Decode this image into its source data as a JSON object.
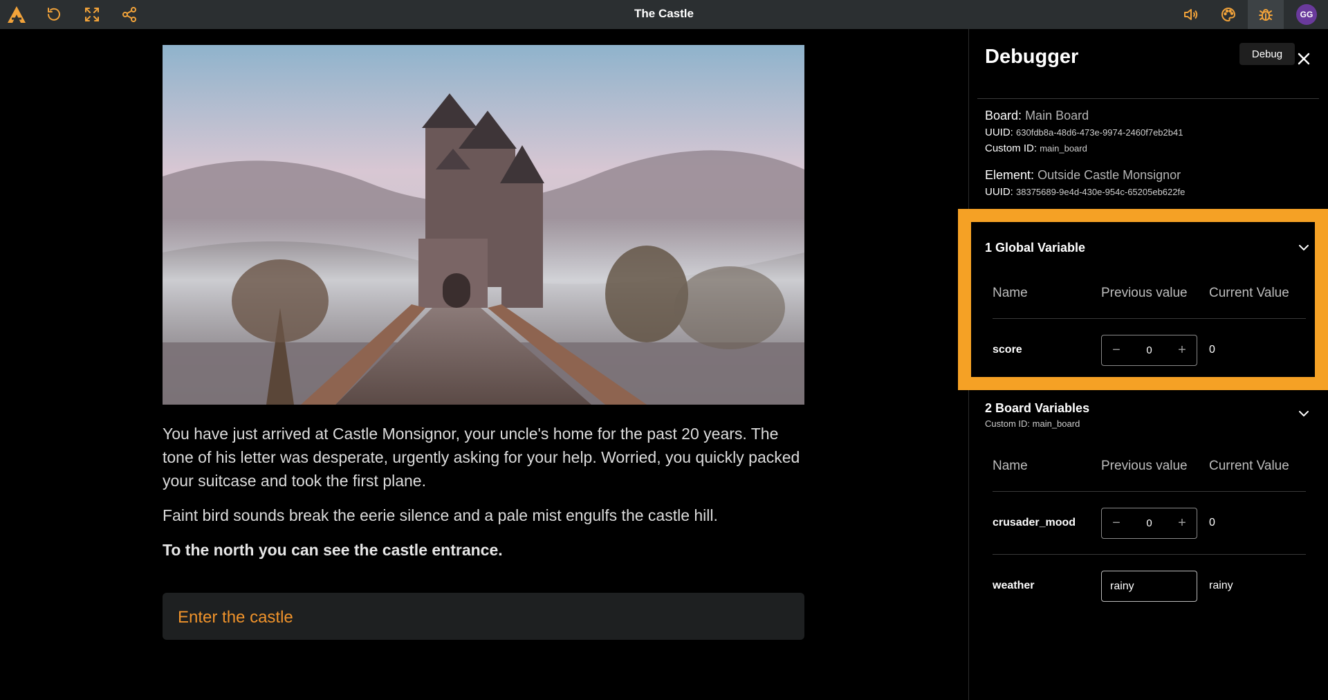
{
  "app": {
    "title": "The Castle",
    "avatar_initials": "GG",
    "accent": "#f2a33a"
  },
  "topbar": {
    "icons": [
      "logo-icon",
      "restart-icon",
      "fullscreen-icon",
      "share-icon",
      "volume-icon",
      "palette-icon",
      "bug-icon"
    ]
  },
  "story": {
    "image_alt": "castle-in-mist",
    "paragraphs": [
      "You have just arrived at Castle Monsignor, your uncle's home for the past 20 years. The tone of his letter was desperate, urgently asking for your help. Worried, you quickly packed your suitcase and took the first plane.",
      "Faint bird sounds break the eerie silence and a pale mist engulfs the castle hill.",
      "To the north you can see the castle entrance."
    ],
    "choice": "Enter the castle"
  },
  "debugger": {
    "title": "Debugger",
    "tooltip": "Debug",
    "board_label": "Board:",
    "board_name": "Main Board",
    "board_uuid_label": "UUID:",
    "board_uuid": "630fdb8a-48d6-473e-9974-2460f7eb2b41",
    "board_custom_label": "Custom ID:",
    "board_custom_id": "main_board",
    "element_label": "Element:",
    "element_name": "Outside Castle Monsignor",
    "element_uuid_label": "UUID:",
    "element_uuid": "38375689-9e4d-430e-954c-65205eb622fe",
    "columns": {
      "name": "Name",
      "previous": "Previous value",
      "current": "Current Value"
    },
    "global": {
      "title": "1 Global Variable",
      "vars": [
        {
          "name": "score",
          "previous": "0",
          "current": "0"
        }
      ]
    },
    "board": {
      "title": "2 Board Variables",
      "custom_label": "Custom ID:",
      "custom_id": "main_board",
      "vars": [
        {
          "name": "crusader_mood",
          "previous": "0",
          "current": "0"
        },
        {
          "name": "weather",
          "previous": "rainy",
          "current": "rainy"
        }
      ]
    }
  }
}
